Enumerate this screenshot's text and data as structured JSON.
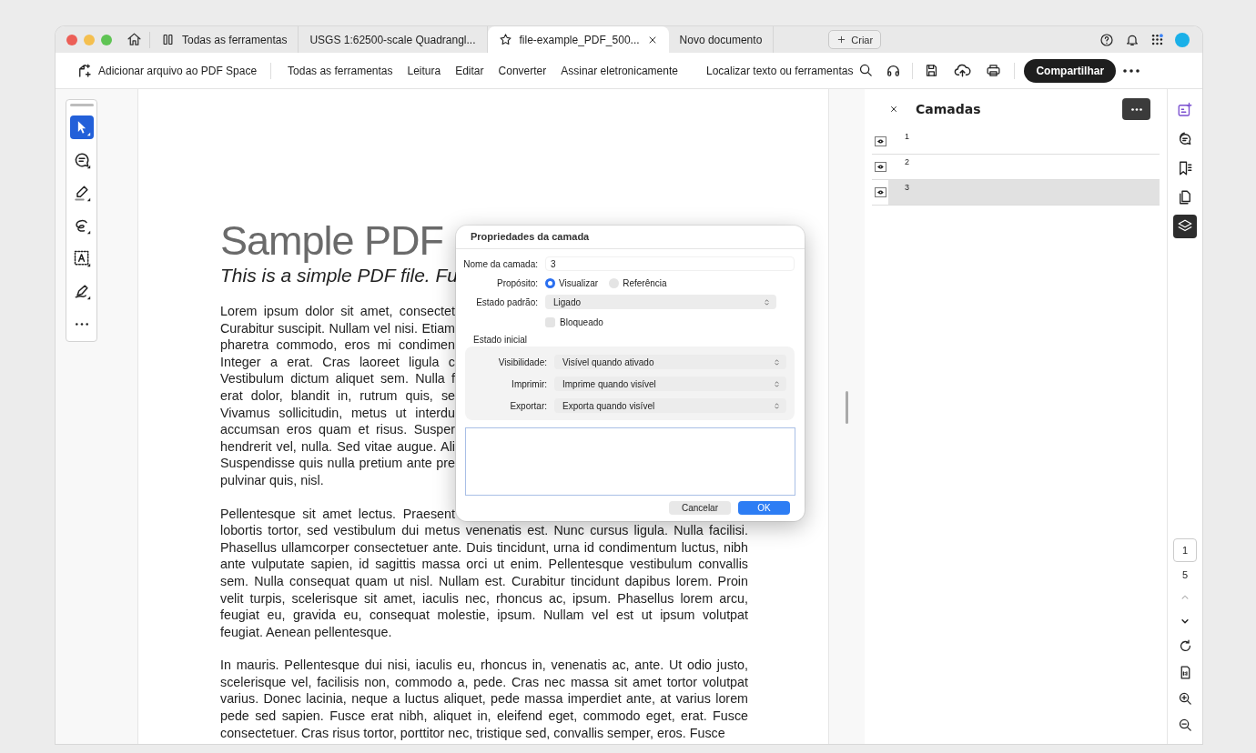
{
  "tabs": [
    {
      "label": "Todas as ferramentas",
      "selected": false
    },
    {
      "label": "USGS 1:62500-scale Quadrangl...",
      "selected": false
    },
    {
      "label": "file-example_PDF_500...",
      "selected": true
    },
    {
      "label": "Novo documento",
      "selected": false
    }
  ],
  "create_button": "Criar",
  "toolbar": {
    "add_file": "Adicionar arquivo ao PDF Space",
    "menu": [
      "Todas as ferramentas",
      "Leitura",
      "Editar",
      "Converter",
      "Assinar eletronicamente"
    ],
    "search": "Localizar texto ou ferramentas",
    "share": "Compartilhar"
  },
  "left_tools": [
    {
      "selected": true
    },
    {
      "selected": false
    },
    {
      "selected": false
    },
    {
      "selected": false
    },
    {
      "selected": false
    },
    {
      "selected": false
    }
  ],
  "document": {
    "title": "Sample PDF",
    "subtitle": "This is a simple PDF file. Fu",
    "paragraphs": [
      {
        "lines": [
          {
            "text": "Lorem ipsum dolor sit amet, consectet",
            "covered": true
          },
          {
            "text": "Curabitur suscipit. Nullam vel nisi. Etiam",
            "covered": true
          },
          {
            "text": "pharetra commodo, eros mi condimen",
            "covered": true
          },
          {
            "text": "Integer a erat. Cras laoreet ligula c",
            "covered": true
          },
          {
            "text": "Vestibulum dictum aliquet sem. Nulla f",
            "covered": true
          },
          {
            "text": "erat dolor, blandit in, rutrum quis, se",
            "covered": true
          },
          {
            "text": "Vivamus sollicitudin, metus ut interdu",
            "covered": true
          },
          {
            "text": "accumsan eros quam et risus. Susper",
            "covered": true
          },
          {
            "text": "hendrerit vel, nulla. Sed vitae augue. Ali",
            "covered": true
          },
          {
            "text": "Suspendisse quis nulla pretium ante pre",
            "covered": true
          },
          {
            "text": "pulvinar quis, nisl.",
            "covered": false
          }
        ]
      },
      {
        "lines": [
          {
            "text": "Pellentesque sit amet lectus. Praesent",
            "covered": true
          },
          {
            "text": "lobortis tortor, sed vestibulum dui metus venenatis est. Nunc cursus ligula. Nulla facilisi.",
            "covered": false
          },
          {
            "text": "Phasellus ullamcorper consectetuer ante. Duis tincidunt, urna id condimentum luctus, nibh",
            "covered": false
          },
          {
            "text": "ante vulputate sapien, id sagittis massa orci ut enim. Pellentesque vestibulum convallis",
            "covered": false
          },
          {
            "text": "sem. Nulla consequat quam ut nisl. Nullam est. Curabitur tincidunt dapibus lorem. Proin",
            "covered": false
          },
          {
            "text": "velit turpis, scelerisque sit amet, iaculis nec, rhoncus ac, ipsum. Phasellus lorem arcu,",
            "covered": false
          },
          {
            "text": "feugiat eu, gravida eu, consequat molestie, ipsum. Nullam vel est ut ipsum volutpat",
            "covered": false
          },
          {
            "text": "feugiat. Aenean pellentesque.",
            "covered": false
          }
        ]
      },
      {
        "lines": [
          {
            "text": "In mauris. Pellentesque dui nisi, iaculis eu, rhoncus in, venenatis ac, ante. Ut odio justo,",
            "covered": false
          },
          {
            "text": "scelerisque vel, facilisis non, commodo a, pede. Cras nec massa sit amet tortor volutpat",
            "covered": false
          },
          {
            "text": "varius. Donec lacinia, neque a luctus aliquet, pede massa imperdiet ante, at varius lorem",
            "covered": false
          },
          {
            "text": "pede sed sapien. Fusce erat nibh, aliquet in, eleifend eget, commodo eget, erat. Fusce",
            "covered": false
          },
          {
            "text": "consectetuer. Cras risus tortor, porttitor nec, tristique sed, convallis semper, eros. Fusce",
            "covered": false
          }
        ]
      }
    ]
  },
  "dialog": {
    "title": "Propriedades da camada",
    "name_label": "Nome da camada:",
    "name_value": "3",
    "purpose_label": "Propósito:",
    "purpose_options": [
      {
        "label": "Visualizar",
        "selected": true
      },
      {
        "label": "Referência",
        "selected": false
      }
    ],
    "default_state_label": "Estado padrão:",
    "default_state_value": "Ligado",
    "locked": {
      "label": "Bloqueado",
      "checked": false
    },
    "initial_state_title": "Estado inicial",
    "initial_state": [
      {
        "label": "Visibilidade:",
        "value": "Visível quando ativado"
      },
      {
        "label": "Imprimir:",
        "value": "Imprime quando visível"
      },
      {
        "label": "Exportar:",
        "value": "Exporta quando visível"
      }
    ],
    "buttons": [
      {
        "label": "Cancelar",
        "kind": "secondary"
      },
      {
        "label": "OK",
        "kind": "primary"
      }
    ]
  },
  "layers_panel": {
    "title": "Camadas",
    "layers": [
      {
        "name": "1",
        "selected": false
      },
      {
        "name": "2",
        "selected": false
      },
      {
        "name": "3",
        "selected": true
      }
    ]
  },
  "rail": {
    "tools": [
      {
        "selected": false
      },
      {
        "selected": false
      },
      {
        "selected": false
      },
      {
        "selected": false
      },
      {
        "selected": true
      }
    ],
    "page_number": "1",
    "page_total": "5"
  }
}
